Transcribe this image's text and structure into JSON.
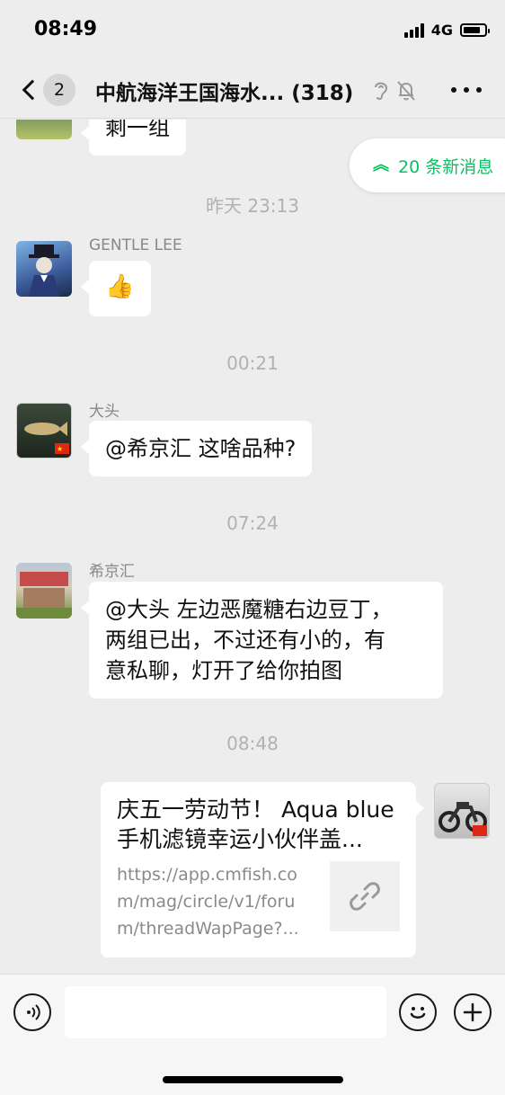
{
  "status_bar": {
    "time": "08:49",
    "network": "4G",
    "battery_level": 0.8
  },
  "nav": {
    "back_count": "2",
    "title": "中航海洋王国海水...",
    "member_count": "(318)",
    "icons": [
      "ear-icon",
      "mute-bell-icon"
    ]
  },
  "new_messages": {
    "label": "20 条新消息"
  },
  "messages": [
    {
      "type": "text",
      "side": "left",
      "sender": "",
      "text": "剩一组"
    },
    {
      "type": "time",
      "text": "昨天 23:13"
    },
    {
      "type": "text",
      "side": "left",
      "sender": "GENTLE LEE",
      "text": "👍"
    },
    {
      "type": "time",
      "text": "00:21"
    },
    {
      "type": "text",
      "side": "left",
      "sender": "大头",
      "text": "@希京汇 这啥品种?"
    },
    {
      "type": "time",
      "text": "07:24"
    },
    {
      "type": "text",
      "side": "left",
      "sender": "希京汇",
      "lines": [
        "@大头 左边恶魔糖右边豆丁，",
        "两组已出，不过还有小的，有",
        "意私聊，灯开了给你拍图"
      ]
    },
    {
      "type": "time",
      "text": "08:48"
    },
    {
      "type": "link",
      "side": "right",
      "title_lines": [
        "庆五一劳动节！ Aqua blue",
        "手机滤镜幸运小伙伴盖..."
      ],
      "url_lines": [
        "https://app.cmfish.co",
        "m/mag/circle/v1/foru",
        "m/threadWapPage?..."
      ]
    }
  ],
  "input": {
    "placeholder": ""
  },
  "colors": {
    "accent": "#07c160",
    "background": "#ededed",
    "bubble": "#ffffff"
  }
}
